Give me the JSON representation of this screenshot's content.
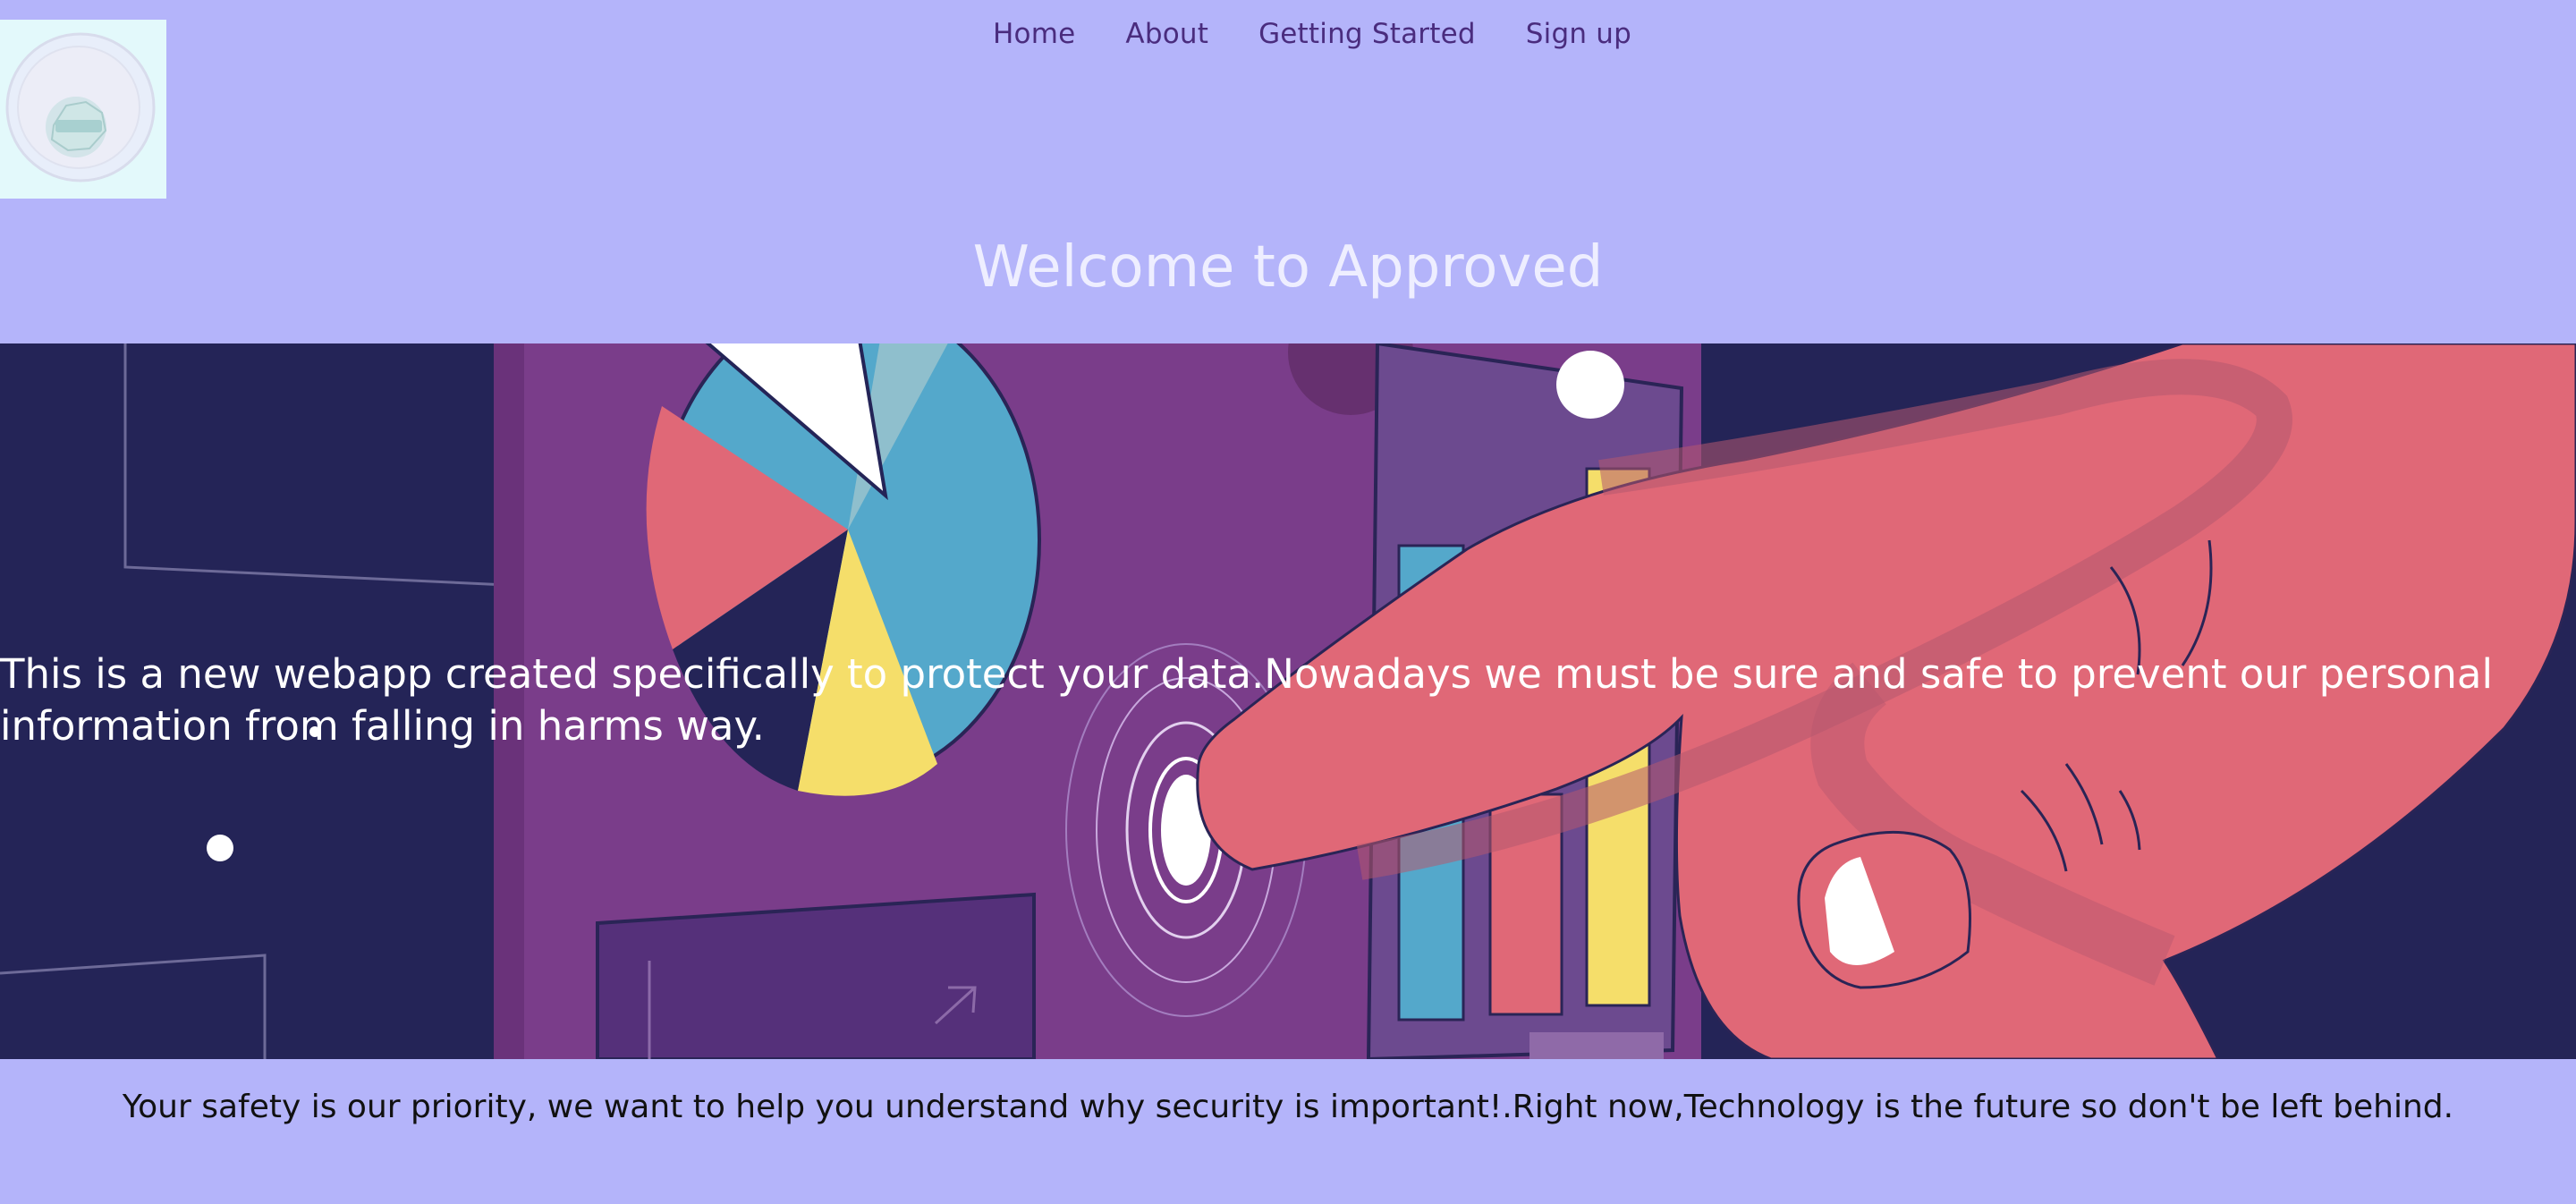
{
  "logo": {
    "alt": "Approved seal logo"
  },
  "nav": {
    "home": "Home",
    "about": "About",
    "getting_started": "Getting Started",
    "signup": "Sign up"
  },
  "welcome": "Welcome to Approved",
  "hero": {
    "text": "This is a new webapp created specifically to protect your data.Nowadays we must be sure and safe to prevent our personal information from falling in harms way."
  },
  "footer_text": "Your safety is our priority, we want to help you understand why security is important!.Right now,Technology is the future so don't be left behind.",
  "colors": {
    "background": "#b4b4fa",
    "hero_bg": "#242457",
    "nav_link": "#4a2c7e",
    "purple_panel": "#7a3d8a",
    "hand": "#e06877",
    "chart_blue": "#54a8cb",
    "chart_yellow": "#f5de6a"
  }
}
